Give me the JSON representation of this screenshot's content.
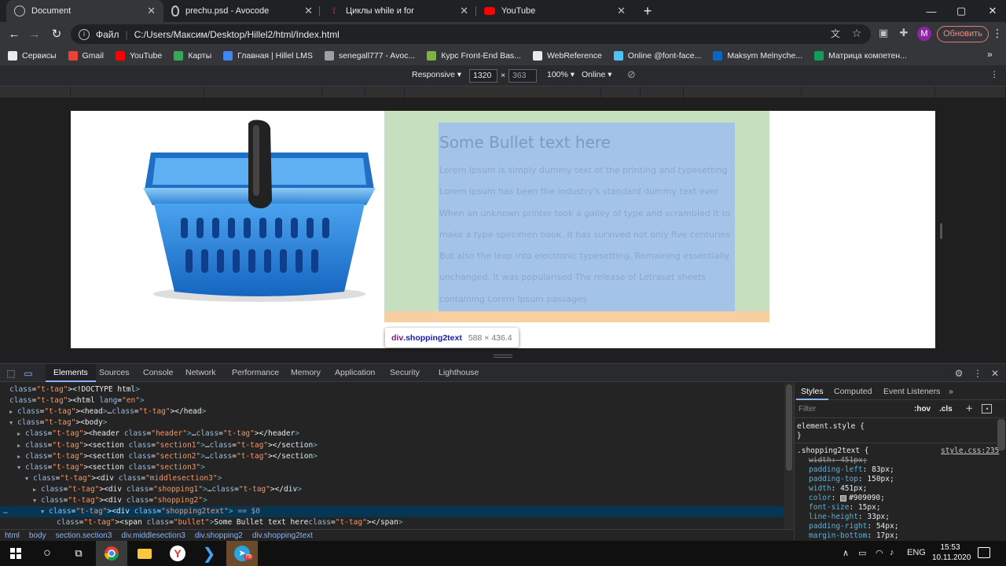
{
  "tabs": [
    {
      "title": "Document",
      "icon": "globe-icon",
      "active": true
    },
    {
      "title": "prechu.psd - Avocode",
      "icon": "avocode-icon",
      "active": false
    },
    {
      "title": "Циклы while и for",
      "icon": "hillel-icon",
      "active": false
    },
    {
      "title": "YouTube",
      "icon": "youtube-icon",
      "active": false
    }
  ],
  "toolbar": {
    "scheme": "Файл",
    "url": "C:/Users/Максим/Desktop/Hillel2/html/Index.html",
    "profile_initial": "M",
    "update_label": "Обновить"
  },
  "bookmarks": [
    {
      "label": "Сервисы",
      "icon": "apps-icon",
      "color": "#e8eaed"
    },
    {
      "label": "Gmail",
      "icon": "gmail-icon",
      "color": "#ea4335"
    },
    {
      "label": "YouTube",
      "icon": "youtube-icon",
      "color": "#ff0000"
    },
    {
      "label": "Карты",
      "icon": "maps-icon",
      "color": "#34a853"
    },
    {
      "label": "Главная | Hillel LMS",
      "icon": "hillel-icon",
      "color": "#4285f4"
    },
    {
      "label": "senegall777 - Avoc...",
      "icon": "avocode-icon",
      "color": "#9aa0a6"
    },
    {
      "label": "Курс Front-End Bas...",
      "icon": "bolt-icon",
      "color": "#7cb342"
    },
    {
      "label": "WebReference",
      "icon": "monitor-icon",
      "color": "#e8eaed"
    },
    {
      "label": "Online @font-face...",
      "icon": "triangle-icon",
      "color": "#4fc3f7"
    },
    {
      "label": "Maksym Melnyche...",
      "icon": "linkedin-icon",
      "color": "#0a66c2"
    },
    {
      "label": "Матрица компетен...",
      "icon": "plus-icon",
      "color": "#0f9d58"
    }
  ],
  "device": {
    "mode": "Responsive",
    "width": "1320",
    "height": "363",
    "zoom": "100%",
    "network": "Online"
  },
  "page": {
    "title": "Some Bullet text here",
    "body": "Lorem Ipsum is simply dummy text of the printing and typesetting Lorem Ipsum has been the industry's standard dummy text ever When an unknown printer took a galley of type and scrambled It to make a type specimen book. It has survived not only five centuries But also the leap into electronic typesetting, Remaining essentially unchanged. It was popularised The release of Letraset sheets containing Lorem Ipsum passages"
  },
  "tooltip": {
    "tag": "div",
    "cls": ".shopping2text",
    "dims": "588 × 436.4"
  },
  "devtools": {
    "tabs": [
      "Elements",
      "Sources",
      "Console",
      "Network",
      "Performance",
      "Memory",
      "Application",
      "Security",
      "Lighthouse"
    ],
    "active_tab": "Elements",
    "dom": [
      {
        "indent": 0,
        "arrow": "",
        "text": "<!DOCTYPE html>"
      },
      {
        "indent": 0,
        "arrow": "",
        "text": "<html lang=\"en\">"
      },
      {
        "indent": 1,
        "arrow": "▶",
        "text": "<head>…</head>"
      },
      {
        "indent": 1,
        "arrow": "▼",
        "text": "<body>"
      },
      {
        "indent": 2,
        "arrow": "▶",
        "text": "<header class=\"header\">…</header>"
      },
      {
        "indent": 2,
        "arrow": "▶",
        "text": "<section class=\"section1\">…</section>"
      },
      {
        "indent": 2,
        "arrow": "▶",
        "text": "<section class=\"section2\">…</section>"
      },
      {
        "indent": 2,
        "arrow": "▼",
        "text": "<section class=\"section3\">"
      },
      {
        "indent": 3,
        "arrow": "▼",
        "text": "<div class=\"middlesection3\">"
      },
      {
        "indent": 4,
        "arrow": "▶",
        "text": "<div class=\"shopping1\">…</div>"
      },
      {
        "indent": 4,
        "arrow": "▼",
        "text": "<div class=\"shopping2\">"
      },
      {
        "indent": 5,
        "arrow": "▼",
        "text": "<div class=\"shopping2text\"> == $0",
        "selected": true
      },
      {
        "indent": 6,
        "arrow": "",
        "text": "<span class=\"bullet\">Some Bullet text here</span>"
      }
    ],
    "breadcrumbs": [
      "html",
      "body",
      "section.section3",
      "div.middlesection3",
      "div.shopping2",
      "div.shopping2text"
    ],
    "styles_tabs": [
      "Styles",
      "Computed",
      "Event Listeners"
    ],
    "filter_placeholder": "Filter",
    "hov": ":hov",
    "cls": ".cls",
    "element_style": "element.style {",
    "element_style_close": "}",
    "rule_selector": ".shopping2text {",
    "rule_source": "style.css:235",
    "declarations": [
      {
        "prop": "width",
        "val": "451px;",
        "overridden": true
      },
      {
        "prop": "padding-left",
        "val": "83px;"
      },
      {
        "prop": "padding-top",
        "val": "150px;"
      },
      {
        "prop": "width",
        "val": "451px;"
      },
      {
        "prop": "color",
        "val": "#909090;",
        "swatch": "#909090"
      },
      {
        "prop": "font-size",
        "val": "15px;"
      },
      {
        "prop": "line-height",
        "val": "33px;"
      },
      {
        "prop": "padding-right",
        "val": "54px;"
      },
      {
        "prop": "margin-bottom",
        "val": "17px;"
      }
    ]
  },
  "taskbar": {
    "lang": "ENG",
    "time": "15:53",
    "date": "10.11.2020",
    "telegram_badge": "79"
  }
}
